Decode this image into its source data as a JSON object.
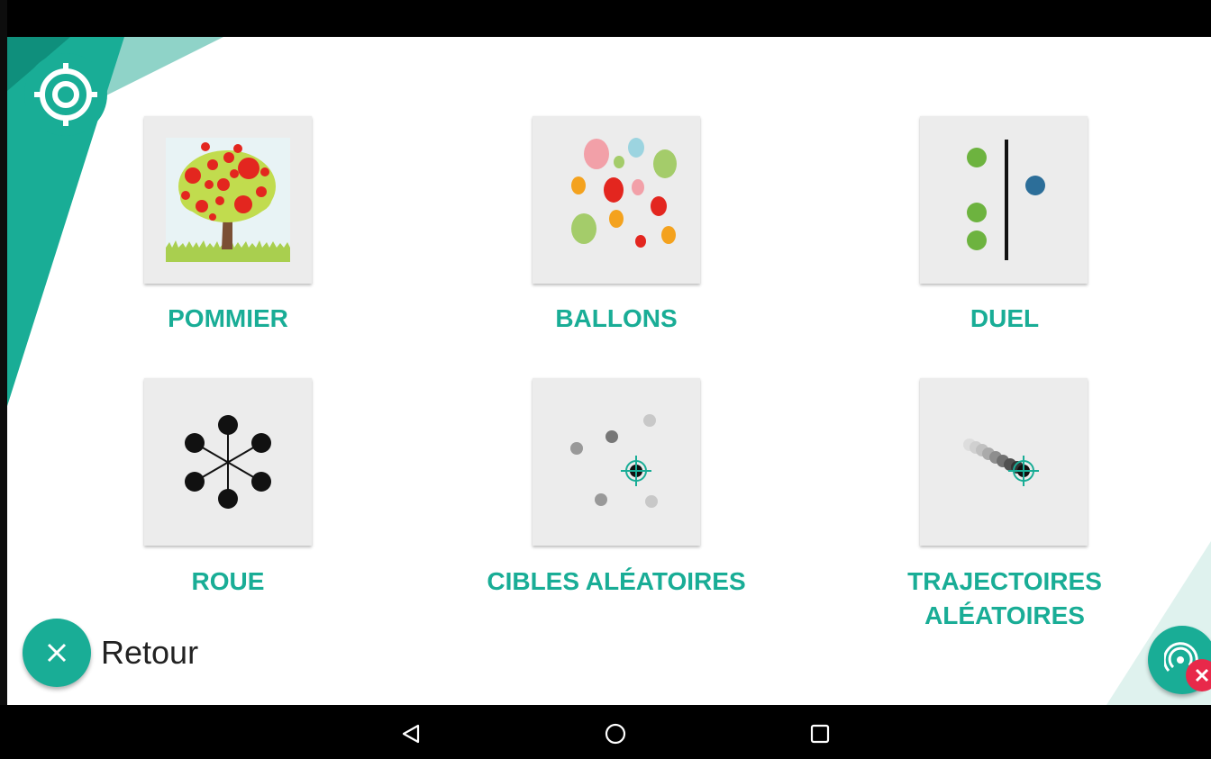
{
  "header": {
    "logo_icon": "target-icon"
  },
  "games": [
    {
      "label": "POMMIER",
      "icon": "apple-tree-icon"
    },
    {
      "label": "BALLONS",
      "icon": "balloons-icon"
    },
    {
      "label": "DUEL",
      "icon": "duel-icon"
    },
    {
      "label": "ROUE",
      "icon": "wheel-icon"
    },
    {
      "label": "CIBLES ALÉATOIRES",
      "icon": "random-targets-icon"
    },
    {
      "label": "TRAJECTOIRES ALÉATOIRES",
      "icon": "random-trajectories-icon"
    }
  ],
  "footer": {
    "back_label": "Retour",
    "back_icon": "close-icon",
    "fab_icon": "eye-tracker-off-icon"
  },
  "navigation": {
    "back_icon": "nav-back-icon",
    "home_icon": "nav-home-icon",
    "recents_icon": "nav-recents-icon"
  },
  "colors": {
    "accent": "#19ad96",
    "accent_light": "#8fd3c8",
    "badge": "#e8294a",
    "tile_background": "#ececec"
  }
}
